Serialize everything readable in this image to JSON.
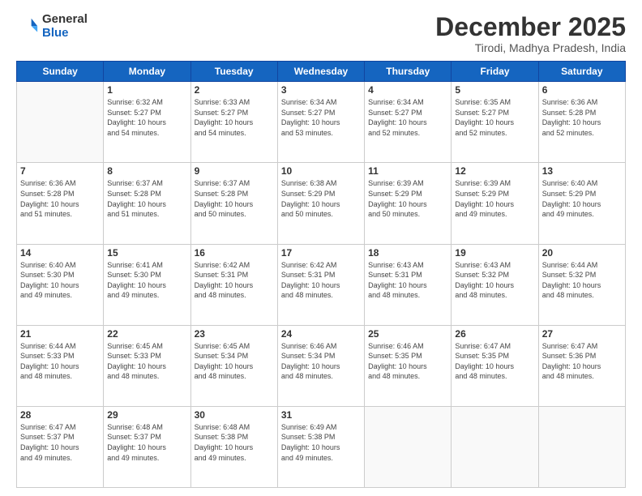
{
  "logo": {
    "general": "General",
    "blue": "Blue"
  },
  "header": {
    "month": "December 2025",
    "location": "Tirodi, Madhya Pradesh, India"
  },
  "weekdays": [
    "Sunday",
    "Monday",
    "Tuesday",
    "Wednesday",
    "Thursday",
    "Friday",
    "Saturday"
  ],
  "weeks": [
    [
      {
        "day": "",
        "info": ""
      },
      {
        "day": "1",
        "info": "Sunrise: 6:32 AM\nSunset: 5:27 PM\nDaylight: 10 hours\nand 54 minutes."
      },
      {
        "day": "2",
        "info": "Sunrise: 6:33 AM\nSunset: 5:27 PM\nDaylight: 10 hours\nand 54 minutes."
      },
      {
        "day": "3",
        "info": "Sunrise: 6:34 AM\nSunset: 5:27 PM\nDaylight: 10 hours\nand 53 minutes."
      },
      {
        "day": "4",
        "info": "Sunrise: 6:34 AM\nSunset: 5:27 PM\nDaylight: 10 hours\nand 52 minutes."
      },
      {
        "day": "5",
        "info": "Sunrise: 6:35 AM\nSunset: 5:27 PM\nDaylight: 10 hours\nand 52 minutes."
      },
      {
        "day": "6",
        "info": "Sunrise: 6:36 AM\nSunset: 5:28 PM\nDaylight: 10 hours\nand 52 minutes."
      }
    ],
    [
      {
        "day": "7",
        "info": "Sunrise: 6:36 AM\nSunset: 5:28 PM\nDaylight: 10 hours\nand 51 minutes."
      },
      {
        "day": "8",
        "info": "Sunrise: 6:37 AM\nSunset: 5:28 PM\nDaylight: 10 hours\nand 51 minutes."
      },
      {
        "day": "9",
        "info": "Sunrise: 6:37 AM\nSunset: 5:28 PM\nDaylight: 10 hours\nand 50 minutes."
      },
      {
        "day": "10",
        "info": "Sunrise: 6:38 AM\nSunset: 5:29 PM\nDaylight: 10 hours\nand 50 minutes."
      },
      {
        "day": "11",
        "info": "Sunrise: 6:39 AM\nSunset: 5:29 PM\nDaylight: 10 hours\nand 50 minutes."
      },
      {
        "day": "12",
        "info": "Sunrise: 6:39 AM\nSunset: 5:29 PM\nDaylight: 10 hours\nand 49 minutes."
      },
      {
        "day": "13",
        "info": "Sunrise: 6:40 AM\nSunset: 5:29 PM\nDaylight: 10 hours\nand 49 minutes."
      }
    ],
    [
      {
        "day": "14",
        "info": "Sunrise: 6:40 AM\nSunset: 5:30 PM\nDaylight: 10 hours\nand 49 minutes."
      },
      {
        "day": "15",
        "info": "Sunrise: 6:41 AM\nSunset: 5:30 PM\nDaylight: 10 hours\nand 49 minutes."
      },
      {
        "day": "16",
        "info": "Sunrise: 6:42 AM\nSunset: 5:31 PM\nDaylight: 10 hours\nand 48 minutes."
      },
      {
        "day": "17",
        "info": "Sunrise: 6:42 AM\nSunset: 5:31 PM\nDaylight: 10 hours\nand 48 minutes."
      },
      {
        "day": "18",
        "info": "Sunrise: 6:43 AM\nSunset: 5:31 PM\nDaylight: 10 hours\nand 48 minutes."
      },
      {
        "day": "19",
        "info": "Sunrise: 6:43 AM\nSunset: 5:32 PM\nDaylight: 10 hours\nand 48 minutes."
      },
      {
        "day": "20",
        "info": "Sunrise: 6:44 AM\nSunset: 5:32 PM\nDaylight: 10 hours\nand 48 minutes."
      }
    ],
    [
      {
        "day": "21",
        "info": "Sunrise: 6:44 AM\nSunset: 5:33 PM\nDaylight: 10 hours\nand 48 minutes."
      },
      {
        "day": "22",
        "info": "Sunrise: 6:45 AM\nSunset: 5:33 PM\nDaylight: 10 hours\nand 48 minutes."
      },
      {
        "day": "23",
        "info": "Sunrise: 6:45 AM\nSunset: 5:34 PM\nDaylight: 10 hours\nand 48 minutes."
      },
      {
        "day": "24",
        "info": "Sunrise: 6:46 AM\nSunset: 5:34 PM\nDaylight: 10 hours\nand 48 minutes."
      },
      {
        "day": "25",
        "info": "Sunrise: 6:46 AM\nSunset: 5:35 PM\nDaylight: 10 hours\nand 48 minutes."
      },
      {
        "day": "26",
        "info": "Sunrise: 6:47 AM\nSunset: 5:35 PM\nDaylight: 10 hours\nand 48 minutes."
      },
      {
        "day": "27",
        "info": "Sunrise: 6:47 AM\nSunset: 5:36 PM\nDaylight: 10 hours\nand 48 minutes."
      }
    ],
    [
      {
        "day": "28",
        "info": "Sunrise: 6:47 AM\nSunset: 5:37 PM\nDaylight: 10 hours\nand 49 minutes."
      },
      {
        "day": "29",
        "info": "Sunrise: 6:48 AM\nSunset: 5:37 PM\nDaylight: 10 hours\nand 49 minutes."
      },
      {
        "day": "30",
        "info": "Sunrise: 6:48 AM\nSunset: 5:38 PM\nDaylight: 10 hours\nand 49 minutes."
      },
      {
        "day": "31",
        "info": "Sunrise: 6:49 AM\nSunset: 5:38 PM\nDaylight: 10 hours\nand 49 minutes."
      },
      {
        "day": "",
        "info": ""
      },
      {
        "day": "",
        "info": ""
      },
      {
        "day": "",
        "info": ""
      }
    ]
  ]
}
